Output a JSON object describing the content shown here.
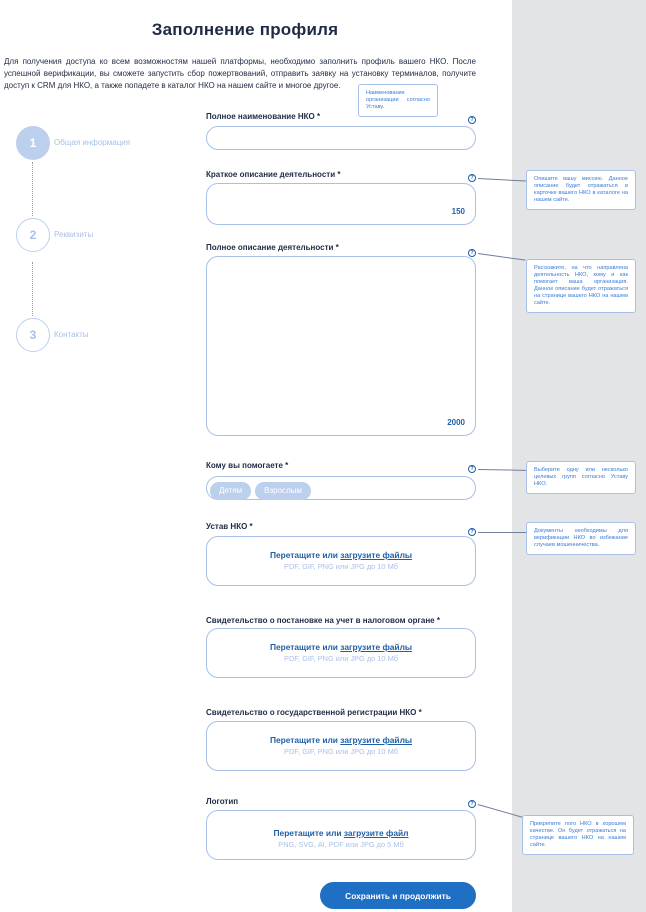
{
  "title": "Заполнение профиля",
  "intro": "Для получения доступа ко всем возможностям нашей платформы, необходимо заполнить профиль вашего НКО. После успешной верификации, вы сможете запустить сбор пожертвований, отправить заявку на установку терминалов, получите доступ к CRM для НКО, а также попадете в каталог НКО на нашем сайте и многое другое.",
  "steps": [
    {
      "number": "1",
      "label": "Общая информация"
    },
    {
      "number": "2",
      "label": "Реквизиты"
    },
    {
      "number": "3",
      "label": "Контакты"
    }
  ],
  "fields": {
    "full_name": {
      "label": "Полное наименование НКО *",
      "value": "",
      "tooltip": "Наименование организации согласно Уставу."
    },
    "short_desc": {
      "label": "Краткое описание деятельности *",
      "value": "",
      "counter": "150",
      "tooltip": "Опишите вашу миссию. Данное описание будет отражаться в карточке вашего НКО в каталоге на нашем сайте."
    },
    "full_desc": {
      "label": "Полное описание деятельности *",
      "value": "",
      "counter": "2000",
      "tooltip": "Расскажите, на что направлена деятельность НКО, кому и как помогает ваша организация. Данное описание будет отражаться на странице вашего НКО на нашем сайте."
    },
    "audience": {
      "label": "Кому вы помогаете *",
      "chips": [
        "Детям",
        "Взрослым"
      ],
      "tooltip": "Выберите одну или несколько целевых групп согласно Уставу НКО."
    },
    "charter": {
      "label": "Устав НКО *",
      "drop_prefix": "Перетащите или ",
      "drop_link": "загрузите файлы",
      "drop_hint": "PDF, GIF, PNG или JPG до 10 Мб",
      "tooltip": "Документы необходимы для верификации НКО во избежание случаев мошенничества."
    },
    "tax_cert": {
      "label": "Свидетельство о постановке на учет в налоговом органе *",
      "drop_prefix": "Перетащите или ",
      "drop_link": "загрузите файлы",
      "drop_hint": "PDF, GIF, PNG или JPG до 10 Мб"
    },
    "reg_cert": {
      "label": "Свидетельство о государственной регистрации НКО *",
      "drop_prefix": "Перетащите или ",
      "drop_link": "загрузите файлы",
      "drop_hint": "PDF, GIF, PNG или JPG до 10 Мб"
    },
    "logo": {
      "label": "Логотип",
      "drop_prefix": "Перетащите или ",
      "drop_link": "загрузите файл",
      "drop_hint": "PNG, SVG, AI, PDF или JPG до 5 Мб",
      "tooltip": "Прикрепите лого НКО в хорошем качестве. Он будет отражаться на странице вашего НКО на нашем сайте."
    }
  },
  "save_button": "Сохранить и продолжить",
  "icons": {
    "help": "help-circle-icon"
  },
  "colors": {
    "accent": "#1f6fc4",
    "border": "#a9c0e6",
    "chip": "#bcd0ee",
    "side_panel": "#e3e4e6"
  }
}
